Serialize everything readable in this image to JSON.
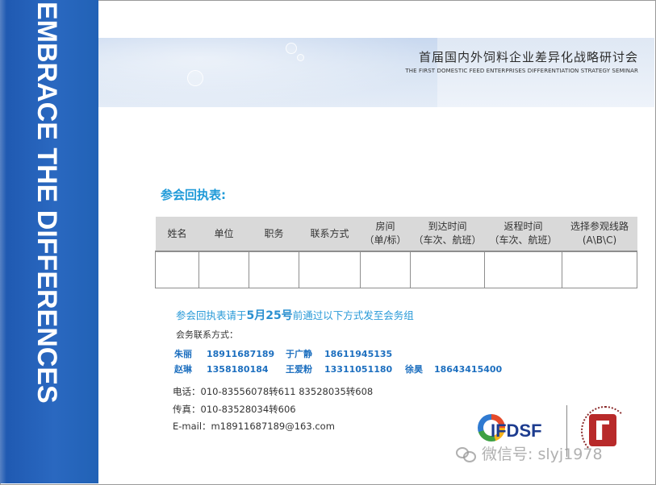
{
  "side_slogan": "EMBRACE THE DIFFERENCES",
  "header": {
    "title_cn": "首届国内外饲料企业差异化战略研讨会",
    "title_en": "THE FIRST DOMESTIC FEED ENTERPRISES DIFFERENTIATION STRATEGY SEMINAR"
  },
  "section_title": "参会回执表:",
  "table": {
    "columns": [
      {
        "line1": "姓名",
        "line2": ""
      },
      {
        "line1": "单位",
        "line2": ""
      },
      {
        "line1": "职务",
        "line2": ""
      },
      {
        "line1": "联系方式",
        "line2": ""
      },
      {
        "line1": "房间",
        "line2": "（单/标）"
      },
      {
        "line1": "到达时间",
        "line2": "（车次、航班）"
      },
      {
        "line1": "返程时间",
        "line2": "（车次、航班）"
      },
      {
        "line1": "选择参观线路",
        "line2": "(A\\B\\C)"
      }
    ]
  },
  "notice": {
    "prefix": "参会回执表请于",
    "date": "5月25号",
    "suffix": "前通过以下方式发至会务组"
  },
  "contact_heading": "会务联系方式：",
  "contacts": [
    [
      {
        "name": "朱丽",
        "phone": "18911687189"
      },
      {
        "name": "于广静",
        "phone": "18611945135"
      }
    ],
    [
      {
        "name": "赵琳",
        "phone": "1358180184"
      },
      {
        "name": "王爱粉",
        "phone": "13311051180"
      },
      {
        "name": "徐昊",
        "phone": "18643415400"
      }
    ]
  ],
  "info": {
    "phone": "电话：010-83556078转611   83528035转608",
    "fax": "传真：010-83528034转606",
    "email": "E-mail：m18911687189@163.com"
  },
  "logos": {
    "ifdsf": "IFDSF"
  },
  "watermark": "微信号: slyj1978"
}
